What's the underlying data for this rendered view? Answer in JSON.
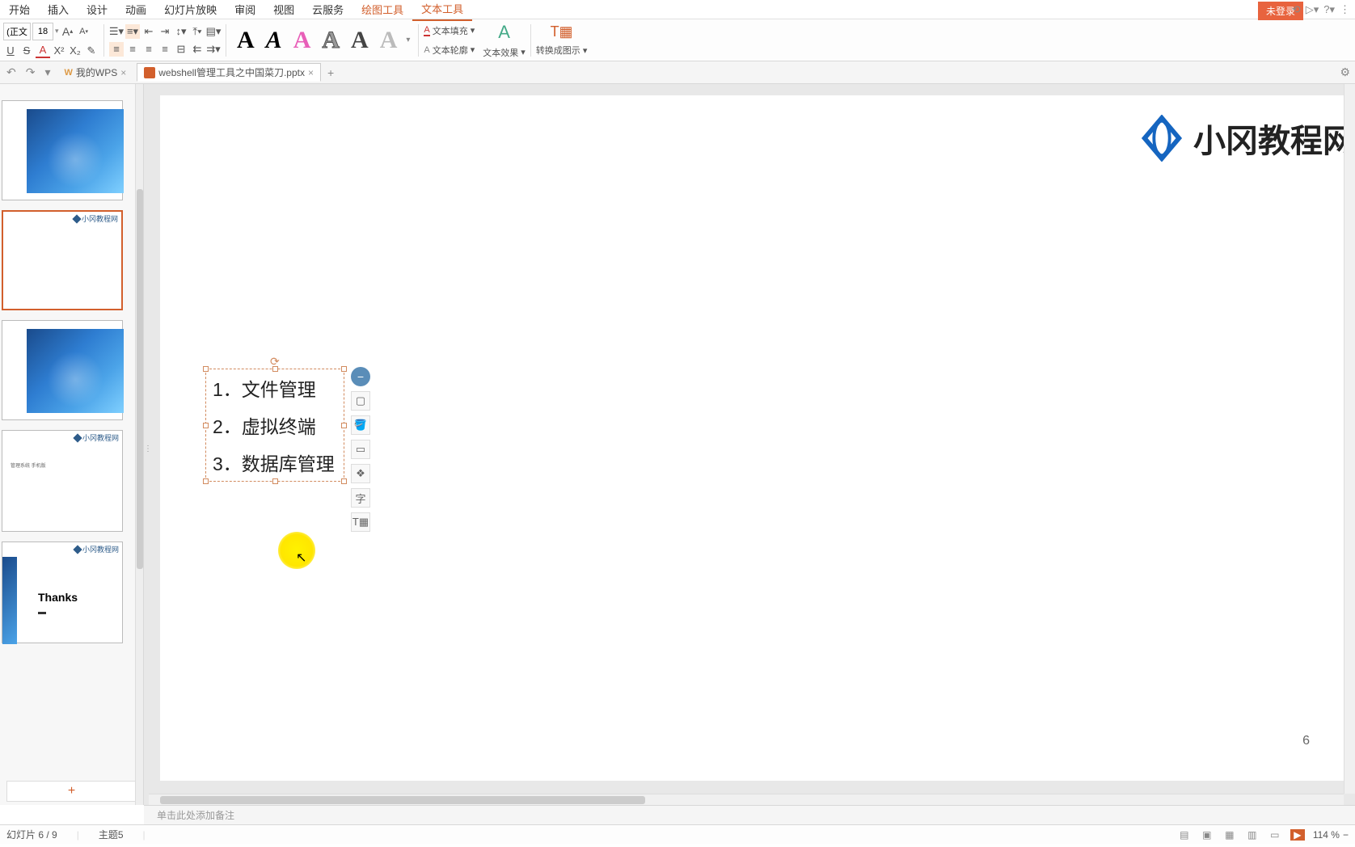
{
  "menu": [
    "开始",
    "插入",
    "设计",
    "动画",
    "幻灯片放映",
    "审阅",
    "视图",
    "云服务",
    "绘图工具",
    "文本工具"
  ],
  "login": "未登录",
  "font": {
    "name": "(正文",
    "size": "18"
  },
  "textLabels": {
    "fill": "文本填充",
    "outline": "文本轮廓",
    "effect": "文本效果",
    "convert": "转换成图示"
  },
  "tabs": [
    {
      "label": "我的WPS"
    },
    {
      "label": "webshell管理工具之中国菜刀.pptx",
      "active": true
    }
  ],
  "slide": {
    "logoText": "小冈教程网",
    "items": [
      "1．文件管理",
      "2．虚拟终端",
      "3．数据库管理"
    ],
    "pageNum": "6"
  },
  "thumbs": {
    "logoSmall": "小冈教程网",
    "thanks": "Thanks"
  },
  "notes": "单击此处添加备注",
  "status": {
    "slide": "幻灯片 6 / 9",
    "theme": "主题5",
    "zoom": "114 %"
  }
}
